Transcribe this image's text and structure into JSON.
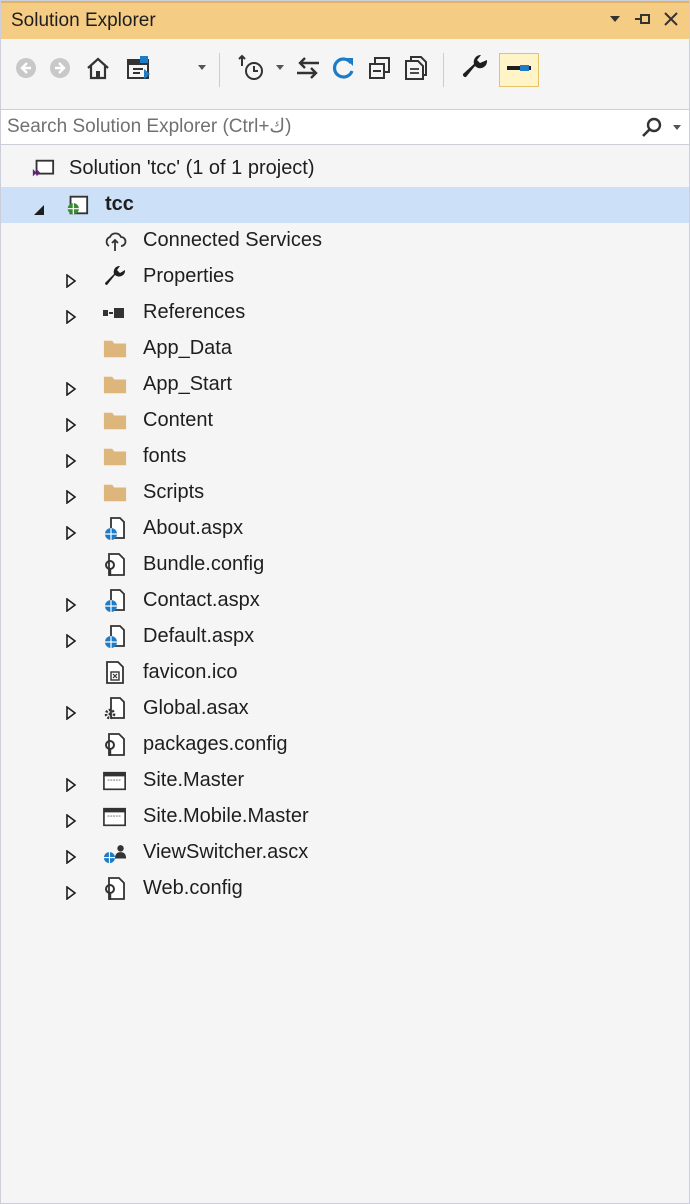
{
  "window": {
    "title": "Solution Explorer"
  },
  "search": {
    "placeholder": "Search Solution Explorer (Ctrl+ك)"
  },
  "colors": {
    "titlebar": "#f5cc84",
    "selection": "#cce0f7",
    "folder": "#dcb67a",
    "accent_blue": "#1e7bc6",
    "accent_purple": "#68217a"
  },
  "tree": {
    "solution": {
      "label": "Solution 'tcc' (1 of 1 project)",
      "icon": "solution-icon"
    },
    "project": {
      "label": "tcc",
      "icon": "web-project-icon",
      "expanded": true,
      "selected": true
    },
    "items": [
      {
        "label": "Connected Services",
        "icon": "connected-services-icon",
        "expandable": false
      },
      {
        "label": "Properties",
        "icon": "wrench-icon",
        "expandable": true
      },
      {
        "label": "References",
        "icon": "references-icon",
        "expandable": true
      },
      {
        "label": "App_Data",
        "icon": "folder-icon",
        "expandable": false
      },
      {
        "label": "App_Start",
        "icon": "folder-icon",
        "expandable": true
      },
      {
        "label": "Content",
        "icon": "folder-icon",
        "expandable": true
      },
      {
        "label": "fonts",
        "icon": "folder-icon",
        "expandable": true
      },
      {
        "label": "Scripts",
        "icon": "folder-icon",
        "expandable": true
      },
      {
        "label": "About.aspx",
        "icon": "aspx-file-icon",
        "expandable": true
      },
      {
        "label": "Bundle.config",
        "icon": "config-file-icon",
        "expandable": false
      },
      {
        "label": "Contact.aspx",
        "icon": "aspx-file-icon",
        "expandable": true
      },
      {
        "label": "Default.aspx",
        "icon": "aspx-file-icon",
        "expandable": true
      },
      {
        "label": "favicon.ico",
        "icon": "ico-file-icon",
        "expandable": false
      },
      {
        "label": "Global.asax",
        "icon": "asax-file-icon",
        "expandable": true
      },
      {
        "label": "packages.config",
        "icon": "config-file-icon",
        "expandable": false
      },
      {
        "label": "Site.Master",
        "icon": "master-page-icon",
        "expandable": true
      },
      {
        "label": "Site.Mobile.Master",
        "icon": "master-page-icon",
        "expandable": true
      },
      {
        "label": "ViewSwitcher.ascx",
        "icon": "user-control-icon",
        "expandable": true
      },
      {
        "label": "Web.config",
        "icon": "config-file-icon",
        "expandable": true
      }
    ]
  }
}
